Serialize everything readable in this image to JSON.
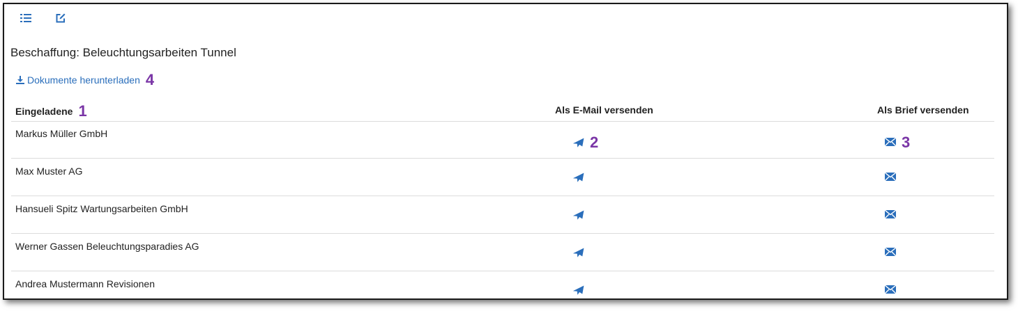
{
  "toolbar": {
    "items": [
      {
        "icon": "list-icon",
        "name": "list-view-button"
      },
      {
        "icon": "edit-icon",
        "name": "edit-button"
      }
    ]
  },
  "page": {
    "title": "Beschaffung: Beleuchtungsarbeiten Tunnel"
  },
  "download": {
    "label": "Dokumente herunterladen",
    "icon": "download-icon",
    "callout": "4"
  },
  "table": {
    "headers": {
      "name": "Eingeladene",
      "name_callout": "1",
      "email": "Als E-Mail versenden",
      "brief": "Als Brief versenden"
    },
    "rows": [
      {
        "name": "Markus Müller GmbH",
        "email_callout": "2",
        "brief_callout": "3"
      },
      {
        "name": "Max Muster AG",
        "email_callout": "",
        "brief_callout": ""
      },
      {
        "name": "Hansueli Spitz Wartungsarbeiten GmbH",
        "email_callout": "",
        "brief_callout": ""
      },
      {
        "name": "Werner Gassen Beleuchtungsparadies AG",
        "email_callout": "",
        "brief_callout": ""
      },
      {
        "name": "Andrea Mustermann Revisionen",
        "email_callout": "",
        "brief_callout": ""
      }
    ]
  },
  "colors": {
    "accent": "#2a6ebb",
    "callout": "#7a35a6",
    "divider": "#dcdcdc"
  }
}
